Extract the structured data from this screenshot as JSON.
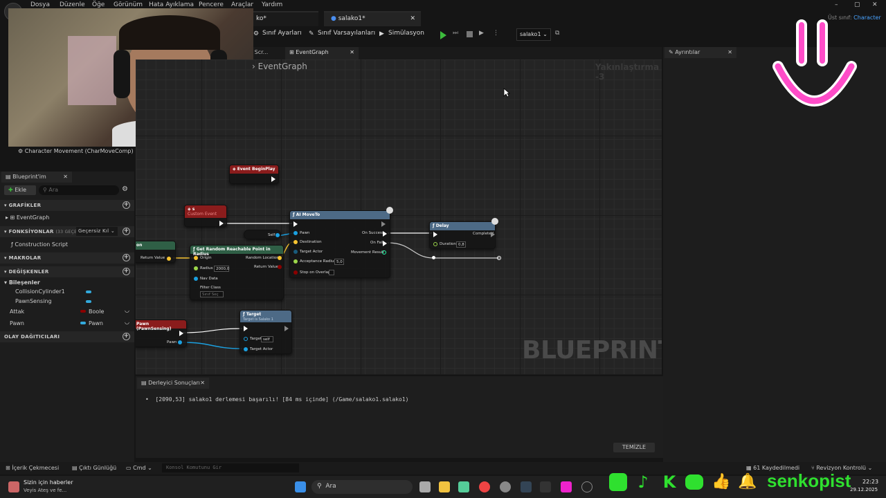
{
  "menu": [
    "Dosya",
    "Düzenle",
    "Öğe",
    "Görünüm",
    "Hata Ayıklama",
    "Pencere",
    "Araçlar",
    "Yardım"
  ],
  "tabs": {
    "partial": "ko*",
    "active": "salako1*"
  },
  "parent_class": {
    "label": "Üst sınıf:",
    "value": "Character"
  },
  "toolbar": {
    "class_settings": "Sınıf Ayarları",
    "class_defaults": "Sınıf Varsayılanları",
    "simulation": "Simülasyon",
    "debug_object": "salako1"
  },
  "graph_tabs": {
    "construction": "n Scr...",
    "event_graph": "EventGraph"
  },
  "graph": {
    "breadcrumb": "EventGraph",
    "zoom": "Yakınlaştırma -3",
    "watermark": "BLUEPRINT"
  },
  "details": {
    "title": "Ayrıntılar"
  },
  "component_hint": "Character Movement (CharMoveComp)",
  "my_blueprint": {
    "title": "Blueprint'im",
    "add": "Ekle",
    "search_placeholder": "Ara",
    "graphs": "GRAFİKLER",
    "event_graph": "EventGraph",
    "functions": "FONKSİYONLAR",
    "functions_count": "(33 GEÇERSİZ KI",
    "override": "Geçersiz Kıl",
    "construction_script": "Construction Script",
    "macros": "MAKROLAR",
    "variables": "DEĞİŞKENLER",
    "components": "Bileşenler",
    "component_items": [
      "CollisionCylinder1",
      "PawnSensing"
    ],
    "vars": [
      {
        "name": "Attak",
        "type": "Boole",
        "color": "#8b0000"
      },
      {
        "name": "Pawn",
        "type": "Pawn",
        "color": "#33aadd"
      }
    ],
    "dispatchers": "OLAY DAĞITICILARI"
  },
  "nodes": {
    "begin_play": "Event BeginPlay",
    "custom_event": "s",
    "custom_event_sub": "Custom Event",
    "return_value_left": "Return Value",
    "self": "Self",
    "get_point": "Get Random Reachable Point in Radius",
    "origin": "Origin",
    "radius": "Radius",
    "radius_val": "2000,0",
    "nav_data": "Nav Data",
    "filter_class": "Filter Class",
    "filter_sel": "Sınıf Seç",
    "random_location": "Random Location",
    "return_value": "Return Value",
    "ai_moveto": "AI MoveTo",
    "pawn": "Pawn",
    "destination": "Destination",
    "target_actor": "Target Actor",
    "acceptance_radius": "Acceptance Radius",
    "acceptance_val": "5,0",
    "stop_on_overlap": "Stop on Overlap",
    "on_success": "On Success",
    "on_fail": "On Fail",
    "movement_result": "Movement Result",
    "delay": "Delay",
    "duration": "Duration",
    "duration_val": "0,8",
    "completed": "Completed",
    "pawn_sensing": "Pawn (PawnSensing)",
    "pawn_out": "Pawn",
    "target_node": "Target",
    "target_node_sub": "Target is Salako 1",
    "target": "Target",
    "target_val": "self",
    "target_actor2": "Target Actor"
  },
  "compiler": {
    "title": "Derleyici Sonuçları",
    "message": "[2090,53] salako1 derlemesi başarılı! [84 ms içinde] (/Game/salako1.salako1)",
    "clear": "TEMİZLE"
  },
  "statusbar": {
    "content_drawer": "İçerik Çekmecesi",
    "output_log": "Çıktı Günlüğü",
    "cmd": "Cmd",
    "console_placeholder": "Konsol Komutunu Gir",
    "saved": "61 Kaydedilmedi",
    "revision": "Revizyon Kontrolü"
  },
  "taskbar": {
    "news_title": "Sizin için haberler",
    "news_sub": "Veyis Ateş ve fe...",
    "search": "Ara",
    "time": "22:23",
    "date": "29.12.2025"
  },
  "overlay": {
    "handle": "senkopist"
  }
}
